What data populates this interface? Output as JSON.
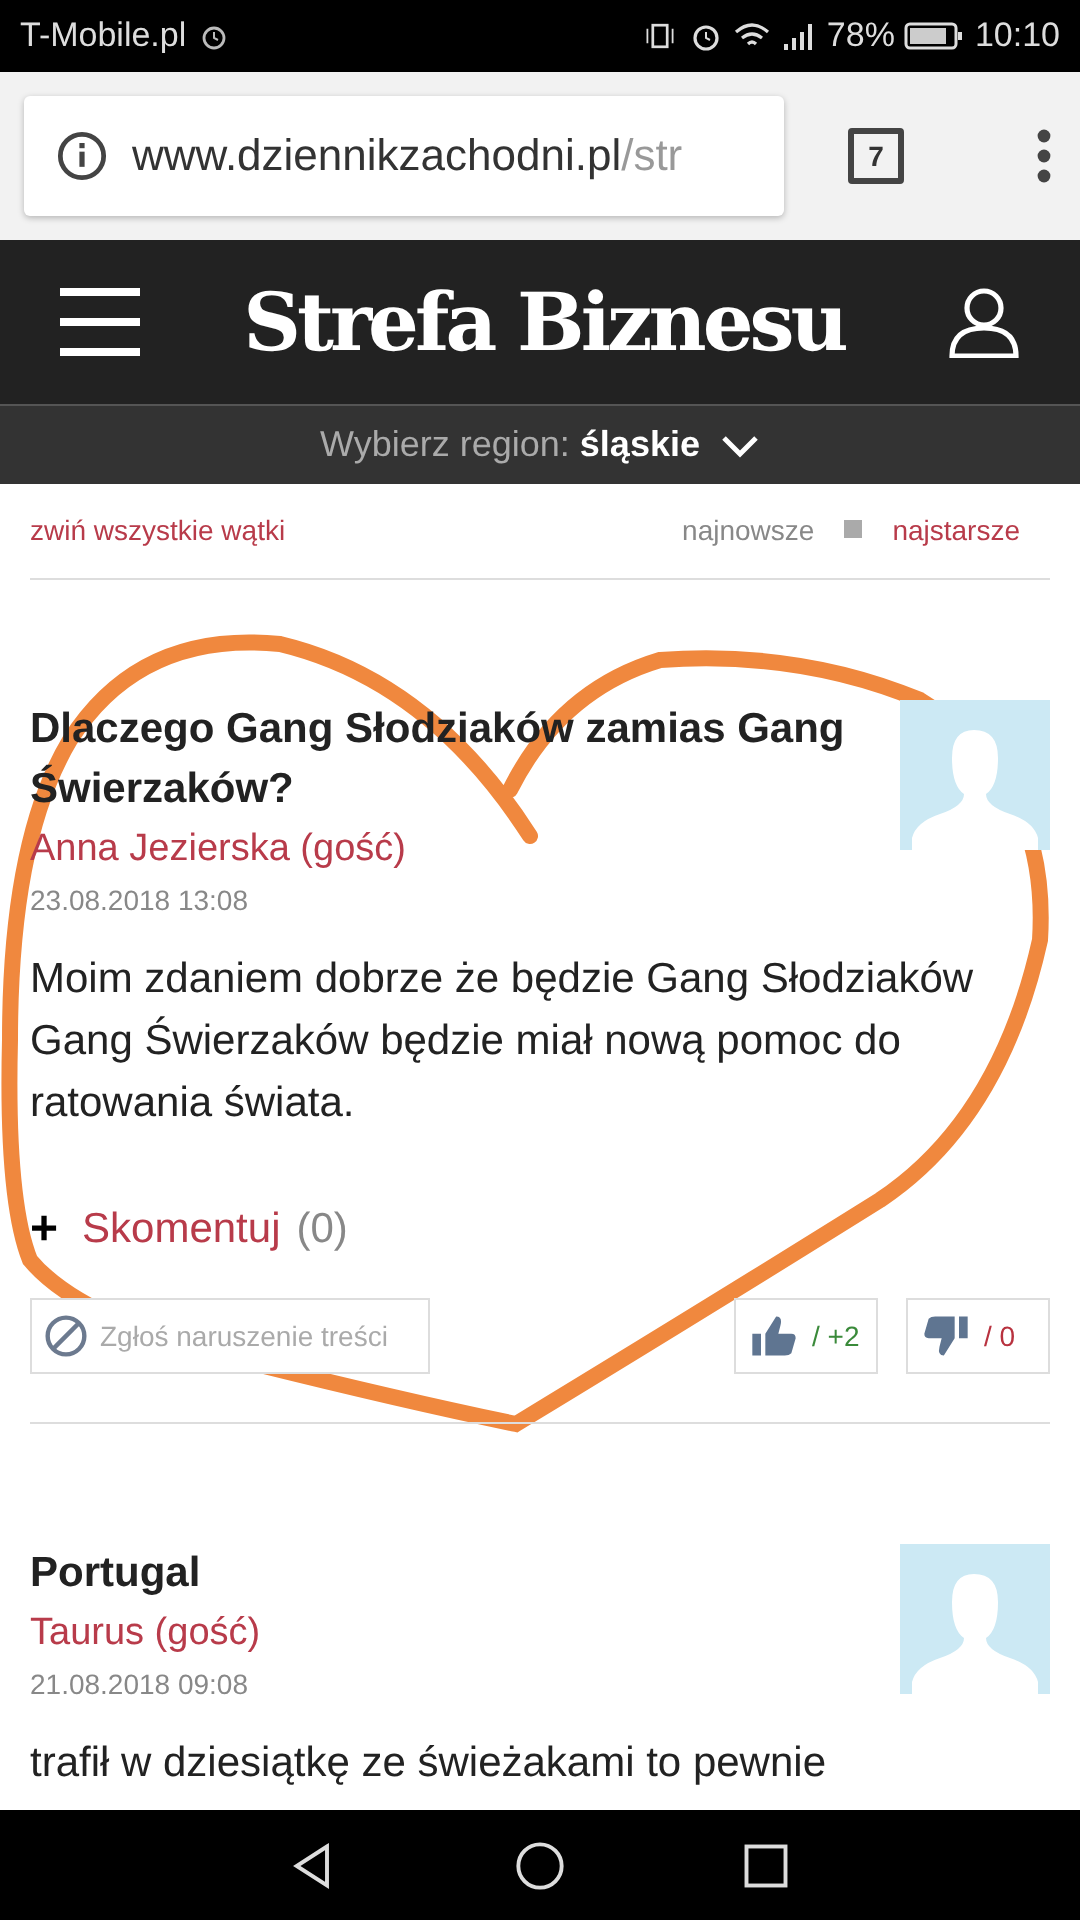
{
  "status_bar": {
    "carrier": "T-Mobile.pl",
    "battery": "78%",
    "time": "10:10"
  },
  "browser": {
    "url_host": "www.dziennikzachodni.pl",
    "url_path": "/str",
    "tab_count": "7"
  },
  "header": {
    "logo": "Strefa Biznesu"
  },
  "region_bar": {
    "label": "Wybierz region:",
    "region": "śląskie"
  },
  "toolbar": {
    "collapse": "zwiń wszystkie wątki",
    "sort": [
      {
        "label": "najnowsze",
        "selected": true
      },
      {
        "label": "najstarsze",
        "selected": false
      }
    ]
  },
  "comments": [
    {
      "title": "Dlaczego Gang Słodziaków zamias Gang Świerzaków?",
      "author": "Anna Jezierska (gość)",
      "date": "23.08.2018 13:08",
      "body": "Moim zdaniem dobrze że będzie Gang Słodziaków Gang Świerzaków będzie miał nową pomoc do ratowania świata.",
      "reply_plus": "+",
      "reply_label": "Skomentuj",
      "reply_count": "(0)",
      "report": "Zgłoś naruszenie treści",
      "likes": "/ +2",
      "dislikes": "/ 0"
    },
    {
      "title": "Portugal",
      "author": "Taurus (gość)",
      "date": "21.08.2018 09:08",
      "body": "trafił w dziesiątkę ze świeżakami to pewnie"
    }
  ],
  "annotation": {
    "kind": "heart"
  }
}
